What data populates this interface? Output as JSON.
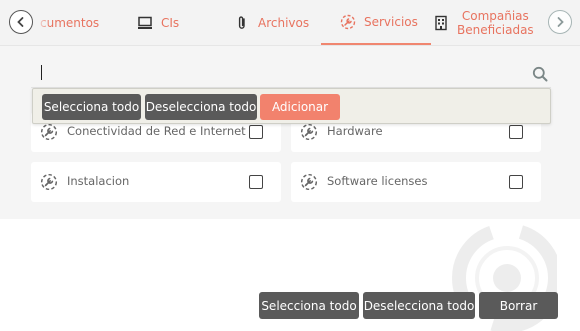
{
  "tabs": [
    {
      "label": "cumentos",
      "icon": "document-icon"
    },
    {
      "label": "CIs",
      "icon": "computer-icon"
    },
    {
      "label": "Archivos",
      "icon": "paperclip-icon"
    },
    {
      "label": "Servicios",
      "icon": "service-icon",
      "active": true
    },
    {
      "label_line1": "Compañias",
      "label_line2": "Beneficiadas",
      "icon": "building-icon"
    }
  ],
  "search": {
    "value": "",
    "placeholder": ""
  },
  "toolbar": {
    "select_all": "Selecciona todo",
    "deselect_all": "Deselecciona todo",
    "add": "Adicionar"
  },
  "services": [
    {
      "label": "Conectividad de Red e Internet",
      "checked": false
    },
    {
      "label": "Hardware",
      "checked": false
    },
    {
      "label": "Instalacion",
      "checked": false
    },
    {
      "label": "Software licenses",
      "checked": false
    }
  ],
  "footer": {
    "select_all": "Selecciona todo",
    "deselect_all": "Deselecciona todo",
    "clear": "Borrar"
  },
  "colors": {
    "accent": "#f2826d",
    "dark_button": "#5a5a5a",
    "tab_text": "#e8735f"
  }
}
